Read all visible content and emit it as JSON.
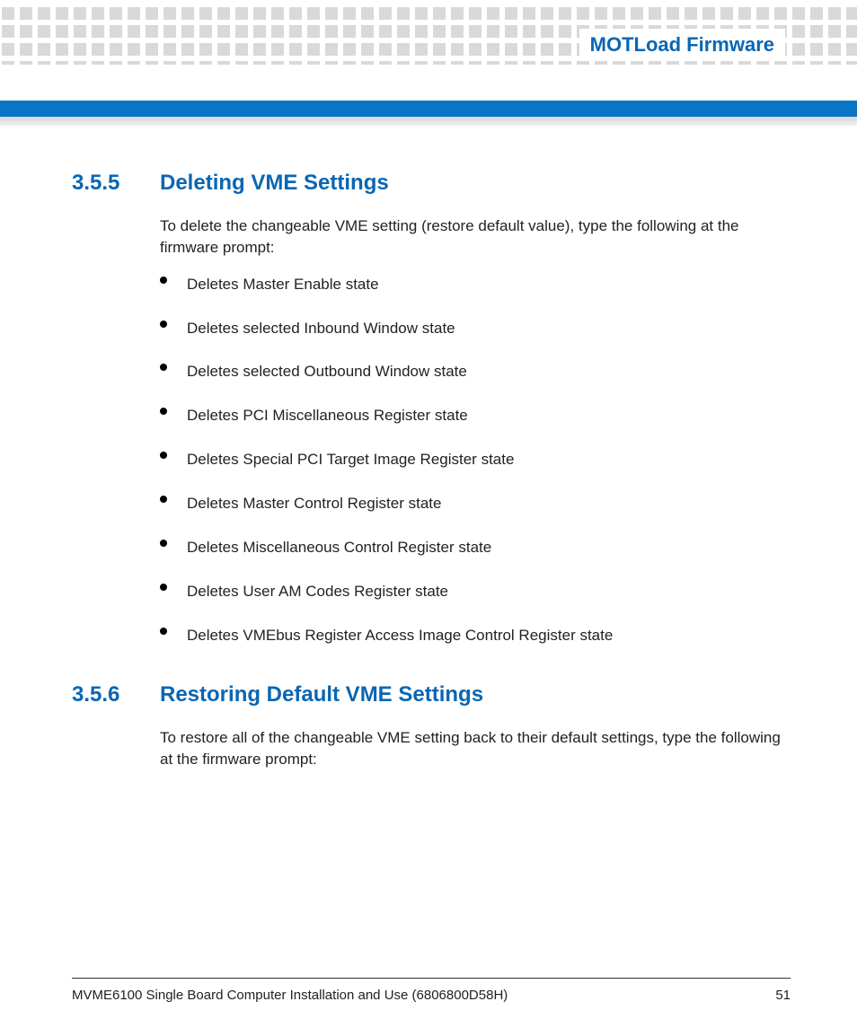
{
  "header": {
    "title": "MOTLoad Firmware"
  },
  "sections": [
    {
      "number": "3.5.5",
      "title": "Deleting VME Settings",
      "intro": "To delete the changeable VME setting (restore default value), type the following at the firmware prompt:",
      "bullets": [
        "Deletes Master Enable state",
        "Deletes selected Inbound Window state",
        "Deletes selected Outbound Window state",
        "Deletes PCI Miscellaneous Register state",
        "Deletes Special PCI Target Image Register state",
        "Deletes Master Control Register state",
        "Deletes Miscellaneous Control Register state",
        "Deletes User AM Codes Register state",
        "Deletes VMEbus Register Access Image Control Register state"
      ]
    },
    {
      "number": "3.5.6",
      "title": "Restoring Default VME Settings",
      "intro": "To restore all of the changeable VME setting back to their default settings, type the following at the firmware prompt:",
      "bullets": []
    }
  ],
  "footer": {
    "doc": "MVME6100 Single Board Computer Installation and Use (6806800D58H)",
    "page": "51"
  }
}
